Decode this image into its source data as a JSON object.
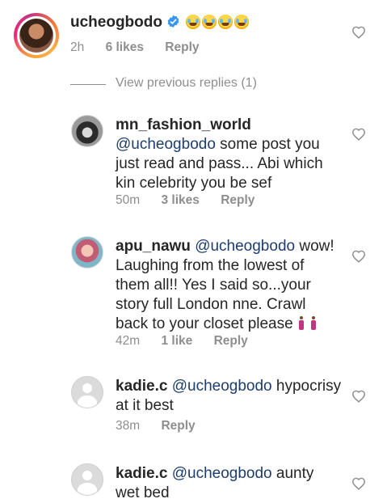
{
  "colors": {
    "text": "#262626",
    "muted": "#8e8e8e",
    "mention": "#1d3d6e",
    "verified": "#3897f0"
  },
  "main_comment": {
    "username": "ucheogbodo",
    "verified": true,
    "emoji": [
      "face-with-tears-of-joy",
      "face-with-tears-of-joy",
      "face-with-tears-of-joy",
      "face-with-tears-of-joy"
    ],
    "time": "2h",
    "likes": "6 likes",
    "reply": "Reply"
  },
  "view_previous": "View previous replies (1)",
  "replies": [
    {
      "username": "mn_fashion_world",
      "mention": "@ucheogbodo",
      "text": " some post you just read and pass... Abi which kin celebrity you be sef",
      "time": "50m",
      "likes": "3 likes",
      "reply": "Reply"
    },
    {
      "username": "apu_nawu",
      "mention": "@ucheogbodo",
      "text": " wow! Laughing from the lowest of them all!! Yes I said so...your story full London nne. Crawl back to your closet please",
      "emoji": [
        "woman-walking",
        "woman-walking"
      ],
      "time": "42m",
      "likes": "1 like",
      "reply": "Reply"
    },
    {
      "username": "kadie.c",
      "mention": "@ucheogbodo",
      "text": " hypocrisy at it best",
      "time": "38m",
      "reply": "Reply"
    },
    {
      "username": "kadie.c",
      "mention": "@ucheogbodo",
      "text": " aunty wet bed"
    }
  ]
}
